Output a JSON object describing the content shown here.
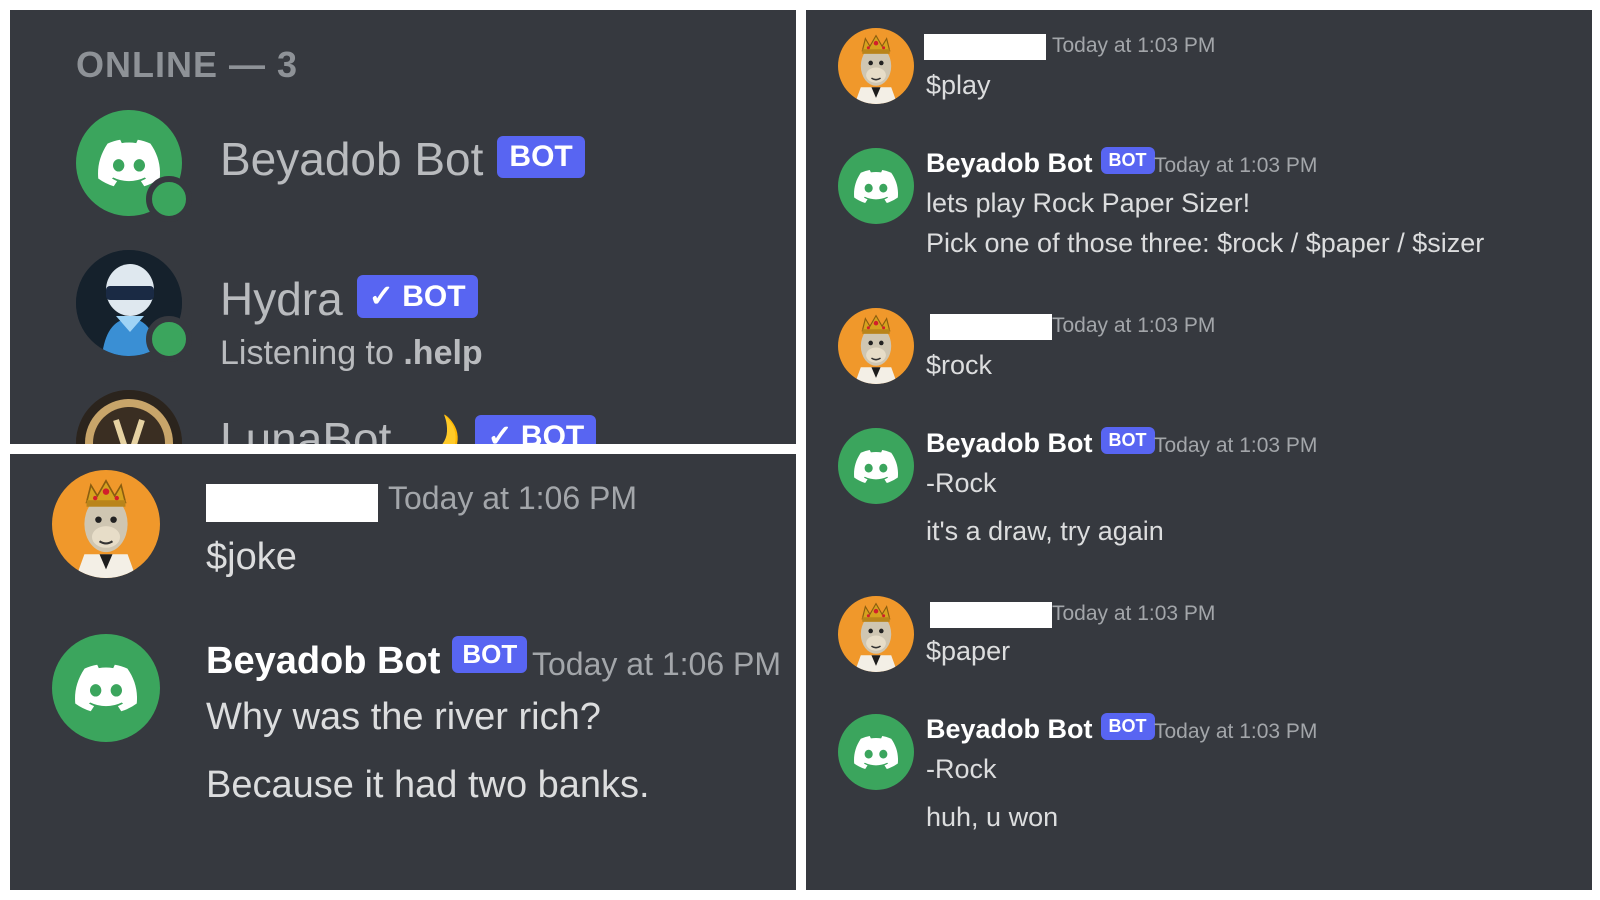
{
  "members_panel": {
    "header": "ONLINE — 3",
    "members": [
      {
        "name": "Beyadob Bot",
        "tag": "BOT",
        "avatar_icon": "discord-logo-icon"
      },
      {
        "name": "Hydra",
        "tag": "✓ BOT",
        "activity_prefix": "Listening to ",
        "activity_value": ".help",
        "avatar_icon": "hydra-avatar-icon"
      },
      {
        "name": "LunaBot",
        "emoji": "🌙",
        "tag": "✓ BOT",
        "avatar_icon": "luna-avatar-icon"
      }
    ],
    "status_color": "#3ba55d"
  },
  "joke_panel": {
    "messages": [
      {
        "author": "",
        "time": "Today at 1:06 PM",
        "lines": [
          "$joke"
        ],
        "avatar_icon": "ape-avatar-icon"
      },
      {
        "author": "Beyadob Bot",
        "tag": "BOT",
        "time": "Today at 1:06 PM",
        "lines": [
          "Why was the river rich?",
          "Because it had two banks."
        ],
        "avatar_icon": "discord-logo-icon"
      }
    ]
  },
  "rps_panel": {
    "messages": [
      {
        "author": "",
        "time": "Today at 1:03 PM",
        "lines": [
          "$play"
        ],
        "avatar_icon": "ape-avatar-icon"
      },
      {
        "author": "Beyadob Bot",
        "tag": "BOT",
        "time": "Today at 1:03 PM",
        "lines": [
          "lets play Rock Paper Sizer!",
          "Pick one of those three: $rock / $paper / $sizer"
        ],
        "avatar_icon": "discord-logo-icon"
      },
      {
        "author": "",
        "time": "Today at 1:03 PM",
        "lines": [
          "$rock"
        ],
        "avatar_icon": "ape-avatar-icon"
      },
      {
        "author": "Beyadob Bot",
        "tag": "BOT",
        "time": "Today at 1:03 PM",
        "lines": [
          "-Rock",
          "it's a draw, try again"
        ],
        "avatar_icon": "discord-logo-icon"
      },
      {
        "author": "",
        "time": "Today at 1:03 PM",
        "lines": [
          "$paper"
        ],
        "avatar_icon": "ape-avatar-icon"
      },
      {
        "author": "Beyadob Bot",
        "tag": "BOT",
        "time": "Today at 1:03 PM",
        "lines": [
          "-Rock",
          "huh, u won"
        ],
        "avatar_icon": "discord-logo-icon"
      }
    ]
  },
  "colors": {
    "background": "#36393f",
    "bot_tag": "#5865f2",
    "discord_green": "#3ba55d",
    "ape_orange": "#f0982b",
    "timestamp": "#a3a6aa"
  }
}
